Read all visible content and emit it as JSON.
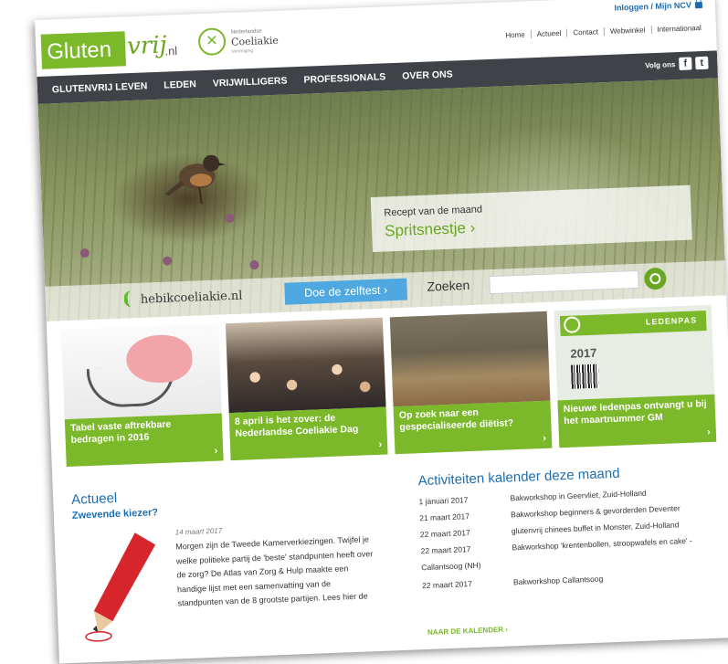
{
  "header": {
    "login": "Inloggen / Mijn NCV",
    "logo": {
      "glutenword": "Gluten",
      "vrij": "vrij",
      "tld": ".nl"
    },
    "ncv_logo": {
      "line1": "Nederlandse",
      "line2": "Coeliakie",
      "line3": "Vereniging"
    },
    "topnav": [
      "Home",
      "Actueel",
      "Contact",
      "Webwinkel",
      "Internationaal"
    ]
  },
  "mainnav": {
    "items": [
      "GLUTENVRIJ LEVEN",
      "LEDEN",
      "VRIJWILLIGERS",
      "PROFESSIONALS",
      "OVER ONS"
    ],
    "volg_ons": "Volg ons",
    "social": [
      "f",
      "t"
    ]
  },
  "hero": {
    "recept_label": "Recept van de maand",
    "recept_link": "Spritsnestje ›"
  },
  "searchbar": {
    "hebik_label": "hebikcoeliakie.nl",
    "zelftest_button": "Doe de zelftest ›",
    "zoeken_label": "Zoeken",
    "zoeken_placeholder": ""
  },
  "tiles": [
    {
      "caption": "Tabel vaste aftrekbare bedragen in 2016"
    },
    {
      "caption": "8 april is het zover: de Nederlandse Coeliakie Dag"
    },
    {
      "caption": "Op zoek naar een gespecialiseerde diëtist?"
    },
    {
      "caption": "Nieuwe ledenpas ontvangt u bij het maartnummer GM",
      "card_title": "LEDENPAS",
      "card_year": "2017"
    }
  ],
  "actueel": {
    "title": "Actueel",
    "subtitle": "Zwevende kiezer?",
    "date": "14 maart 2017",
    "text": "Morgen zijn de Tweede Kamerverkiezingen. Twijfel je welke politieke partij de 'beste' standpunten heeft over de zorg? De Atlas van Zorg & Hulp maakte een handige lijst met een samenvatting van de standpunten van de 8 grootste partijen. Lees hier de"
  },
  "kalender": {
    "title": "Activiteiten kalender deze maand",
    "rows": [
      {
        "date": "1 januari 2017",
        "event": "Bakworkshop in Geervliet, Zuid-Holland"
      },
      {
        "date": "21 maart 2017",
        "event": "Bakworkshop beginners & gevorderden Deventer"
      },
      {
        "date": "22 maart 2017",
        "event": "glutenvrij chinees buffet in Monster, Zuid-Holland"
      },
      {
        "date": "22 maart 2017",
        "event": "Bakworkshop 'krentenbollen, stroopwafels en cake' -"
      },
      {
        "date": "Callantsoog (NH)",
        "event": ""
      },
      {
        "date": "22 maart 2017",
        "event": "Bakworkshop Callantsoog"
      }
    ],
    "link": "NAAR DE KALENDER ›"
  },
  "colors": {
    "green": "#7bb82a",
    "blue": "#1a6db3",
    "nav": "#3f4347",
    "zelftest": "#4fa8e0"
  }
}
